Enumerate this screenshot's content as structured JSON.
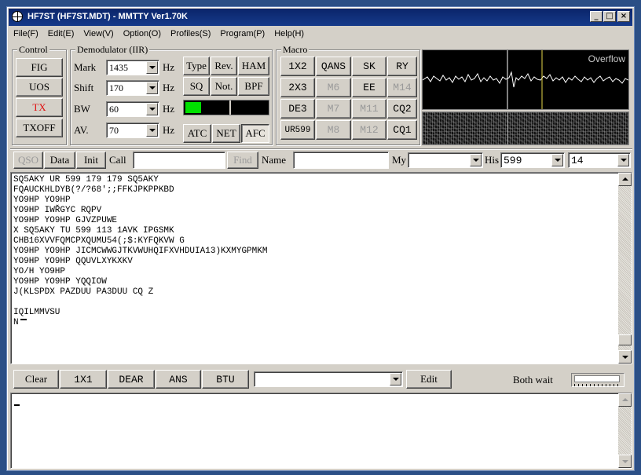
{
  "window": {
    "title": "HF7ST (HF7ST.MDT) - MMTTY Ver1.70K",
    "min": "_",
    "max": "□",
    "close": "×"
  },
  "menu": [
    "File(F)",
    "Edit(E)",
    "View(V)",
    "Option(O)",
    "Profiles(S)",
    "Program(P)",
    "Help(H)"
  ],
  "control": {
    "caption": "Control",
    "buttons": [
      "FIG",
      "UOS",
      "TX",
      "TXOFF"
    ],
    "tx_color": "#e01010"
  },
  "demod": {
    "caption": "Demodulator (IIR)",
    "rows": [
      {
        "label": "Mark",
        "value": "1435",
        "unit": "Hz"
      },
      {
        "label": "Shift",
        "value": "170",
        "unit": "Hz"
      },
      {
        "label": "BW",
        "value": "60",
        "unit": "Hz"
      },
      {
        "label": "AV.",
        "value": "70",
        "unit": "Hz"
      }
    ],
    "buttons": {
      "type": "Type",
      "rev": "Rev.",
      "ham": "HAM",
      "sq": "SQ",
      "not": "Not.",
      "bpf": "BPF",
      "atc": "ATC",
      "net": "NET",
      "afc": "AFC"
    },
    "level_color": "#00e000"
  },
  "macro": {
    "caption": "Macro",
    "buttons": [
      [
        "1X2",
        "QANS",
        "SK",
        "RY"
      ],
      [
        "2X3",
        "M6",
        "EE",
        "M14"
      ],
      [
        "DE3",
        "M7",
        "M11",
        "CQ2"
      ],
      [
        "UR599",
        "M8",
        "M12",
        "CQ1"
      ]
    ],
    "dimmed": [
      "M6",
      "M14",
      "M7",
      "M11",
      "M8",
      "M12"
    ]
  },
  "scope": {
    "status": "Overflow"
  },
  "qso_bar": {
    "qso": "QSO",
    "data": "Data",
    "init": "Init",
    "call_label": "Call",
    "call_value": "",
    "find": "Find",
    "name_label": "Name",
    "name_value": "",
    "my_label": "My",
    "my_value": "",
    "his_label": "His",
    "his_value": "599",
    "extra_value": "14"
  },
  "rx_lines": [
    "SQ5AKY UR 599 179 179 SQ5AKY",
    "FQAUCKHLDYB(?/?68';;FFKJPKPPKBD",
    "YO9HP YO9HP",
    "YO9HP IWŘGYC RQPV",
    "YO9HP YO9HP GJVZPUWE",
    "X SQ5AKY TU 599 113 1AVK IPGSMK",
    "CHB16XVVFQMCPXQUMU54(;$:KYFQKVW G",
    "YO9HP YO9HP JICMCWWGJTKVWUHQIFXVHDUIA13)KXMYGPMKM",
    "YO9HP YO9HP QQUVLXYKXKV",
    "YO/H YO9HP",
    "YO9HP YO9HP YQQIOW",
    "J(KLSPDX PAZDUU PA3DUU CQ Z",
    "",
    "IQILMMVSU",
    "N"
  ],
  "tx_bar": {
    "clear": "Clear",
    "b1x1": "1X1",
    "dear": "DEAR",
    "ans": "ANS",
    "btu": "BTU",
    "combo_value": "",
    "edit": "Edit",
    "both_wait": "Both wait"
  }
}
